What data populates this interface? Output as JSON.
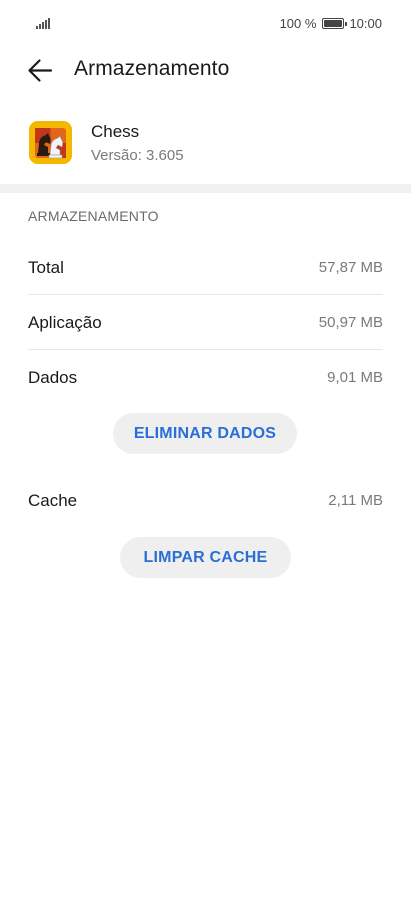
{
  "status_bar": {
    "battery_percent": "100 %",
    "time": "10:00",
    "icons": [
      "signal-icon",
      "battery-icon"
    ]
  },
  "header": {
    "back_icon": "arrow-left-icon",
    "title": "Armazenamento"
  },
  "app": {
    "name": "Chess",
    "version": "Versão: 3.605",
    "icon": "chess-app-icon"
  },
  "storage": {
    "section_title": "ARMAZENAMENTO",
    "rows": [
      {
        "label": "Total",
        "value": "57,87 MB"
      },
      {
        "label": "Aplicação",
        "value": "50,97 MB"
      },
      {
        "label": "Dados",
        "value": "9,01 MB"
      }
    ],
    "clear_data_label": "ELIMINAR DADOS",
    "cache": {
      "label": "Cache",
      "value": "2,11 MB"
    },
    "clear_cache_label": "LIMPAR CACHE"
  },
  "colors": {
    "accent": "#2a6fd6",
    "button_bg": "#efefef",
    "app_icon_bg": "#f5b800"
  }
}
